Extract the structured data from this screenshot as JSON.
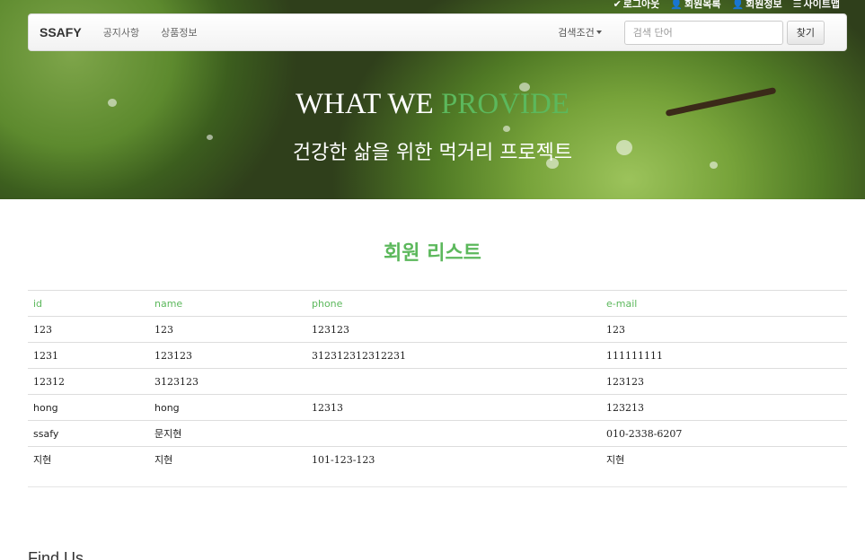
{
  "util_links": [
    {
      "icon": "check-icon",
      "label": "로그아웃"
    },
    {
      "icon": "user-icon",
      "label": "회원목록"
    },
    {
      "icon": "user-icon",
      "label": "회원정보"
    },
    {
      "icon": "list-icon",
      "label": "사이트맵"
    }
  ],
  "navbar": {
    "brand": "SSAFY",
    "links": [
      "공지사항",
      "상품정보"
    ],
    "dropdown_label": "검색조건",
    "search_placeholder": "검색 단어",
    "search_button": "찾기"
  },
  "hero": {
    "title_part1": "WHAT WE ",
    "title_accent": "PROVIDE",
    "subtitle": "건강한 삶을 위한 먹거리 프로젝트"
  },
  "section_title": "회원 리스트",
  "table": {
    "headers": [
      "id",
      "name",
      "phone",
      "e-mail"
    ],
    "rows": [
      [
        "123",
        "123",
        "123123",
        "123"
      ],
      [
        "1231",
        "123123",
        "312312312312231",
        "111111111"
      ],
      [
        "12312",
        "3123123",
        "",
        "123123"
      ],
      [
        "hong",
        "hong",
        "12313",
        "123213"
      ],
      [
        "ssafy",
        "문지현",
        "",
        "010-2338-6207"
      ],
      [
        "지현",
        "지현",
        "101-123-123",
        "지현"
      ]
    ]
  },
  "footer_title": "Find Us",
  "colors": {
    "accent": "#5cb85c",
    "hero_green": "#77a33a"
  }
}
